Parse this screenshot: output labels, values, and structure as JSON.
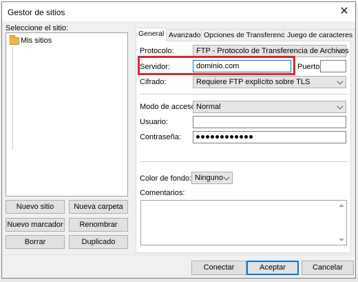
{
  "window": {
    "title": "Gestor de sitios",
    "close_glyph": "✕"
  },
  "left": {
    "label": "Seleccione el sitio:",
    "tree_root": "Mis sitios",
    "buttons": {
      "new_site": "Nuevo sitio",
      "new_folder": "Nueva carpeta",
      "new_bookmark": "Nuevo marcador",
      "rename": "Renombrar",
      "delete": "Borrar",
      "duplicate": "Duplicado"
    }
  },
  "tabs": [
    "General",
    "Avanzado",
    "Opciones de Transferencia",
    "Juego de caracteres"
  ],
  "general": {
    "protocol_label": "Protocolo:",
    "protocol_value": "FTP - Protocolo de Transferencia de Archivos",
    "server_label": "Servidor:",
    "server_value": "dominio.com",
    "port_label": "Puerto:",
    "port_value": "",
    "encryption_label": "Cifrado:",
    "encryption_value": "Requiere FTP explícito sobre TLS",
    "access_mode_label": "Modo de acceso:",
    "access_mode_value": "Normal",
    "user_label": "Usuario:",
    "user_value": "",
    "password_label": "Contraseña:",
    "password_dots": 12,
    "bgcolor_label": "Color de fondo:",
    "bgcolor_value": "Ninguno",
    "comments_label": "Comentarios:"
  },
  "footer": {
    "connect": "Conectar",
    "accept": "Aceptar",
    "cancel": "Cancelar"
  },
  "colors": {
    "highlight": "#e0232e",
    "focus": "#0078d7",
    "folder": "#e8b84a"
  },
  "icons": {
    "folder": "folder-icon",
    "close": "close-icon",
    "dropdown": "chevron-down-icon"
  }
}
